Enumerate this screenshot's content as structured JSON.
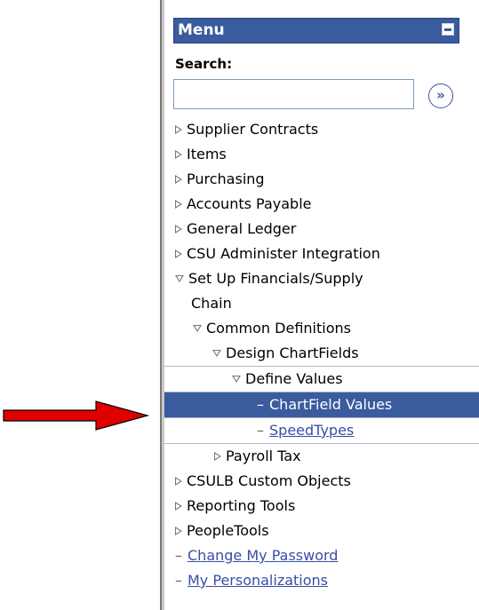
{
  "menu": {
    "title": "Menu",
    "search_label": "Search:",
    "search_value": "",
    "go_symbol": "»",
    "items": [
      {
        "label": "Supplier Contracts",
        "type": "folder-closed",
        "indent": 0
      },
      {
        "label": "Items",
        "type": "folder-closed",
        "indent": 0
      },
      {
        "label": "Purchasing",
        "type": "folder-closed",
        "indent": 0
      },
      {
        "label": "Accounts Payable",
        "type": "folder-closed",
        "indent": 0
      },
      {
        "label": "General Ledger",
        "type": "folder-closed",
        "indent": 0
      },
      {
        "label": "CSU Administer Integration",
        "type": "folder-closed",
        "indent": 0
      },
      {
        "label": "Set Up Financials/Supply",
        "type": "folder-open",
        "indent": 0
      },
      {
        "label": "Chain",
        "type": "continuation",
        "indent": 0
      },
      {
        "label": "Common Definitions",
        "type": "folder-open",
        "indent": 1
      },
      {
        "label": "Design ChartFields",
        "type": "folder-open",
        "indent": 2
      },
      {
        "label": "Define Values",
        "type": "folder-open",
        "indent": 3
      },
      {
        "label": "ChartField Values",
        "type": "page-selected",
        "indent": 4
      },
      {
        "label": "SpeedTypes",
        "type": "page-link",
        "indent": 4
      },
      {
        "label": "Payroll Tax",
        "type": "folder-closed",
        "indent": 2
      },
      {
        "label": "CSULB Custom Objects",
        "type": "folder-closed",
        "indent": 0
      },
      {
        "label": "Reporting Tools",
        "type": "folder-closed",
        "indent": 0
      },
      {
        "label": "PeopleTools",
        "type": "folder-closed",
        "indent": 0
      },
      {
        "label": "Change My Password",
        "type": "page-link",
        "indent": 0
      },
      {
        "label": "My Personalizations",
        "type": "page-link",
        "indent": 0
      }
    ]
  },
  "colors": {
    "header_bg": "#3a5b9e",
    "selected_bg": "#3a5b9e",
    "link": "#3a4da8",
    "arrow": "#e00000"
  },
  "icons": {
    "collapse": "minus-icon",
    "go": "double-chevron-right-icon",
    "folder_closed": "triangle-right-icon",
    "folder_open": "triangle-down-icon",
    "pointer": "red-arrow-icon"
  }
}
